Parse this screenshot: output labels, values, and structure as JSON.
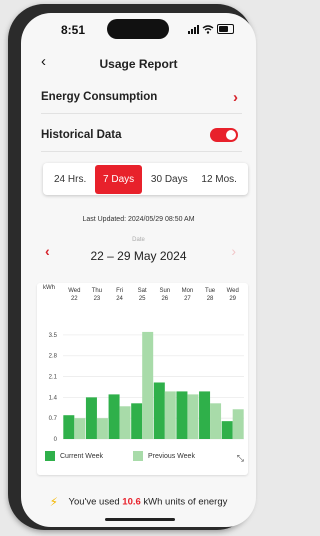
{
  "status_bar": {
    "time": "8:51"
  },
  "header": {
    "back_icon": "chevron-left-icon",
    "title": "Usage Report"
  },
  "sections": {
    "energy_consumption": "Energy Consumption",
    "historical_data": "Historical Data",
    "historical_data_enabled": true
  },
  "tabs": [
    {
      "label": "24 Hrs.",
      "active": false
    },
    {
      "label": "7 Days",
      "active": true
    },
    {
      "label": "30 Days",
      "active": false
    },
    {
      "label": "12 Mos.",
      "active": false
    }
  ],
  "last_updated": "Last Updated: 2024/05/29 08:50 AM",
  "date_nav": {
    "label": "Date",
    "range": "22 – 29 May 2024"
  },
  "colors": {
    "accent": "#e8212b",
    "current_week": "#2fb04a",
    "previous_week": "#a8dba9",
    "bolt": "#f5b800"
  },
  "chart_data": {
    "type": "bar",
    "unit_label": "kWh",
    "categories": [
      {
        "day": "Wed",
        "date": "22"
      },
      {
        "day": "Thu",
        "date": "23"
      },
      {
        "day": "Fri",
        "date": "24"
      },
      {
        "day": "Sat",
        "date": "25"
      },
      {
        "day": "Sun",
        "date": "26"
      },
      {
        "day": "Mon",
        "date": "27"
      },
      {
        "day": "Tue",
        "date": "28"
      },
      {
        "day": "Wed",
        "date": "29"
      }
    ],
    "yticks": [
      "0",
      "0.7",
      "1.4",
      "2.1",
      "2.8",
      "3.5"
    ],
    "ylim": [
      0,
      3.9
    ],
    "series": [
      {
        "name": "Current Week",
        "values": [
          0.8,
          1.4,
          1.5,
          1.2,
          1.9,
          1.6,
          1.6,
          0.6
        ]
      },
      {
        "name": "Previous Week",
        "values": [
          0.7,
          0.7,
          1.1,
          3.6,
          1.6,
          1.5,
          1.2,
          1.0
        ]
      }
    ]
  },
  "legend": {
    "current": "Current Week",
    "previous": "Previous Week"
  },
  "footer": {
    "prefix": "You've used",
    "value": "10.6",
    "suffix": "kWh units of energy"
  }
}
